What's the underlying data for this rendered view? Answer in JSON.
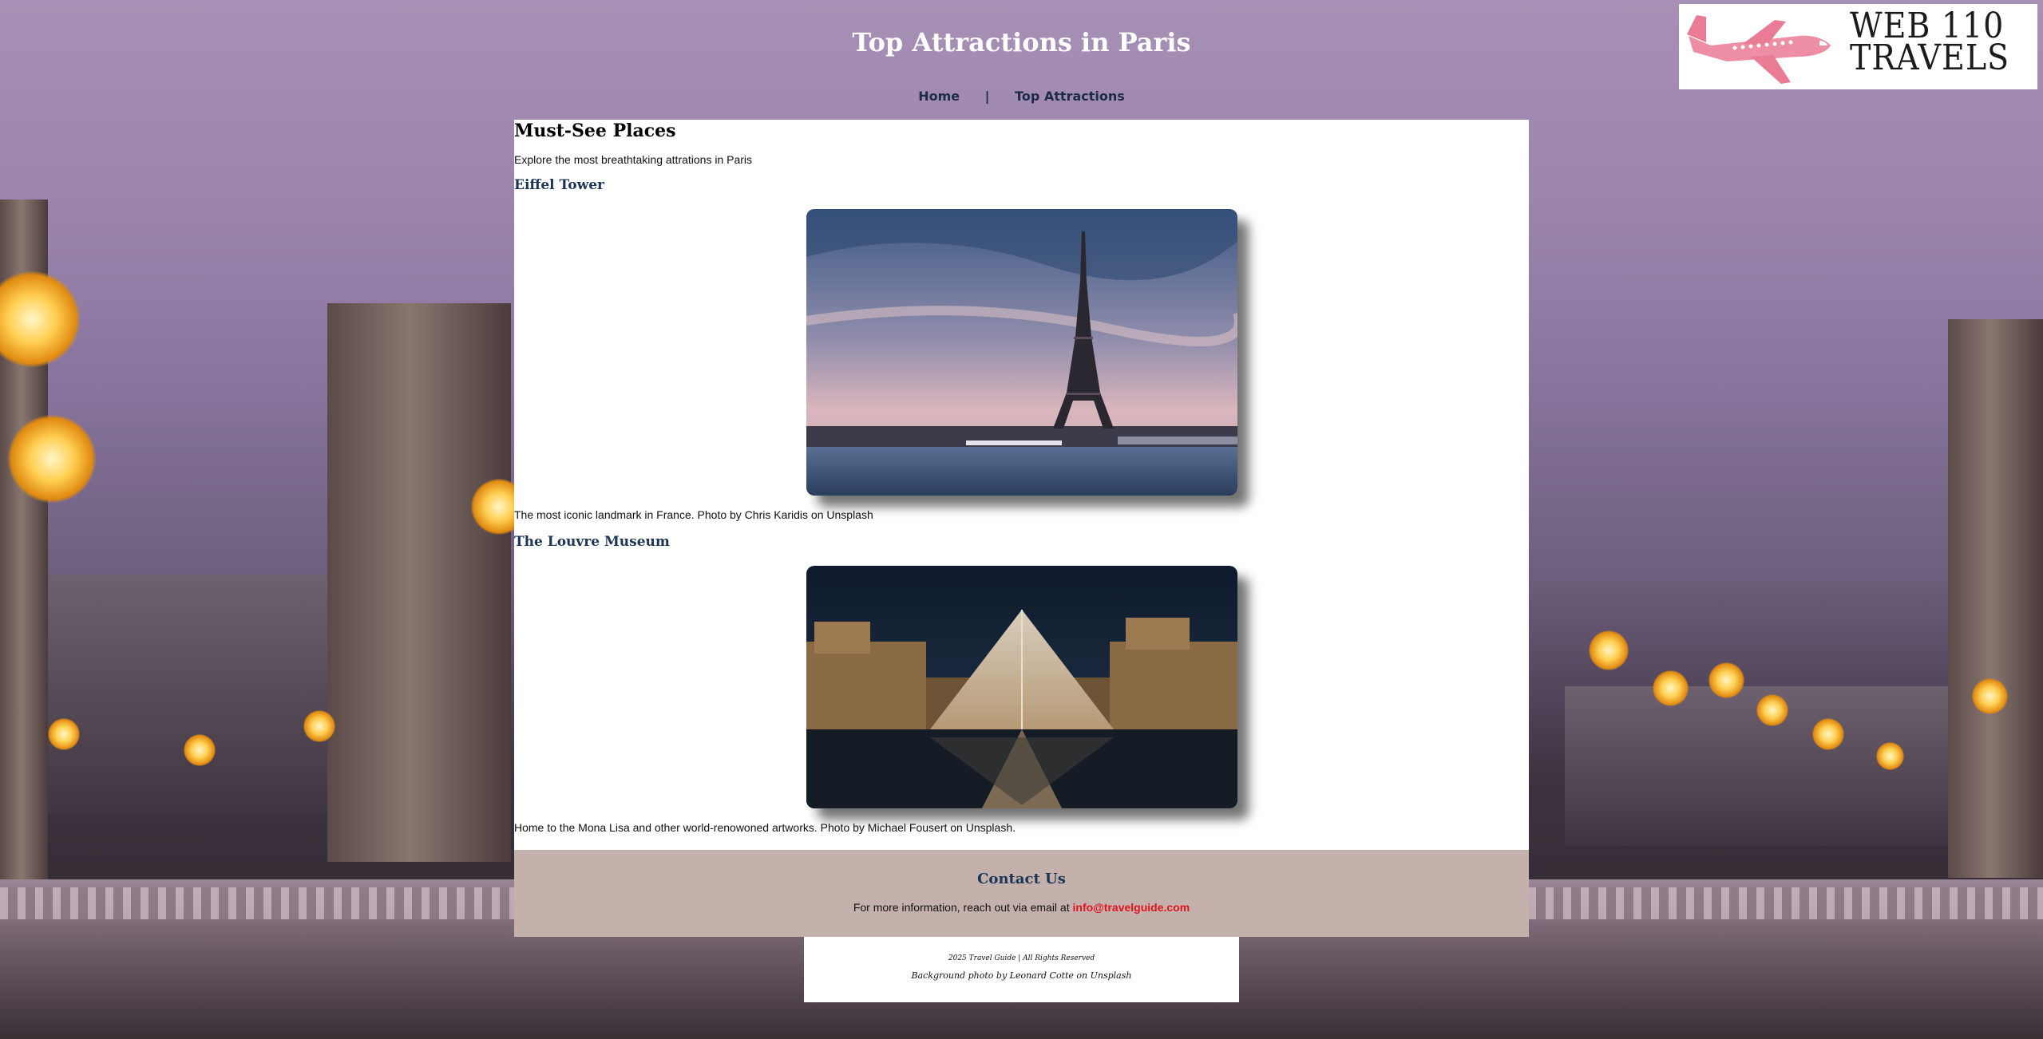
{
  "header": {
    "title": "Top Attractions in Paris",
    "nav": [
      {
        "label": "Home"
      },
      {
        "label": "Top Attractions"
      }
    ],
    "nav_separator": "|",
    "logo": {
      "line1": "WEB 110",
      "line2": "TRAVELS",
      "accent": "#ee8ea4"
    }
  },
  "main": {
    "heading": "Must-See Places",
    "intro": "Explore the most breathtaking attrations in Paris",
    "attractions": [
      {
        "title": "Eiffel Tower",
        "caption": "The most iconic landmark in France. Photo by Chris Karidis on Unsplash"
      },
      {
        "title": "The Louvre Museum",
        "caption": "Home to the Mona Lisa and other world-renowoned artworks. Photo by Michael Fousert on Unsplash."
      }
    ]
  },
  "contact": {
    "heading": "Contact Us",
    "text": "For more information, reach out via email at",
    "email": "info@travelguide.com"
  },
  "footer": {
    "line1": "2025 Travel Guide | All Rights Reserved",
    "line2": "Background photo by Leonard Cotte on Unsplash"
  },
  "colors": {
    "nav_text": "#1c2b48",
    "heading_blue": "#1c3557",
    "contact_bg": "#c4b1ac",
    "email_red": "#e0131c"
  }
}
